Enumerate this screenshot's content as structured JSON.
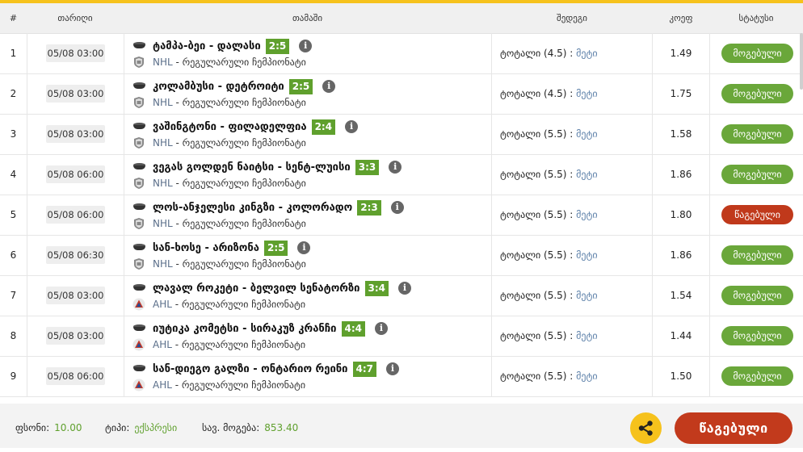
{
  "header": {
    "num": "#",
    "date": "თარიღი",
    "match": "თამაში",
    "bet": "შედეგი",
    "odds": "კოეფ",
    "status": "სტატუსი"
  },
  "colors": {
    "accent": "#f6c21c",
    "won": "#6aa73a",
    "lost": "#c0391b",
    "score": "#5fa02d"
  },
  "rows": [
    {
      "num": "1",
      "date": "05/08 03:00",
      "teams": "ტამპა-ბეი - დალასი",
      "score": "2:5",
      "league": "NHL",
      "stage": " - რეგულარული ჩემპიონატი",
      "bet": "ტოტალი (4.5) : ",
      "pick": "მეტი",
      "odds": "1.49",
      "status": "მოგებული",
      "league_icon": "nhl-logo"
    },
    {
      "num": "2",
      "date": "05/08 03:00",
      "teams": "კოლამბუსი - დეტროიტი",
      "score": "2:5",
      "league": "NHL",
      "stage": " - რეგულარული ჩემპიონატი",
      "bet": "ტოტალი (4.5) : ",
      "pick": "მეტი",
      "odds": "1.75",
      "status": "მოგებული",
      "league_icon": "nhl-logo"
    },
    {
      "num": "3",
      "date": "05/08 03:00",
      "teams": "ვაშინგტონი - ფილადელფია",
      "score": "2:4",
      "league": "NHL",
      "stage": " - რეგულარული ჩემპიონატი",
      "bet": "ტოტალი (5.5) : ",
      "pick": "მეტი",
      "odds": "1.58",
      "status": "მოგებული",
      "league_icon": "nhl-logo"
    },
    {
      "num": "4",
      "date": "05/08 06:00",
      "teams": "ვეგას გოლდენ ნაიტსი - სენტ-ლუისი",
      "score": "3:3",
      "league": "NHL",
      "stage": " - რეგულარული ჩემპიონატი",
      "bet": "ტოტალი (5.5) : ",
      "pick": "მეტი",
      "odds": "1.86",
      "status": "მოგებული",
      "league_icon": "nhl-logo"
    },
    {
      "num": "5",
      "date": "05/08 06:00",
      "teams": "ლოს-ანჯელესი კინგზი - კოლორადო",
      "score": "2:3",
      "league": "NHL",
      "stage": " - რეგულარული ჩემპიონატი",
      "bet": "ტოტალი (5.5) : ",
      "pick": "მეტი",
      "odds": "1.80",
      "status": "წაგებული",
      "league_icon": "nhl-logo"
    },
    {
      "num": "6",
      "date": "05/08 06:30",
      "teams": "სან-ხოსე - არიზონა",
      "score": "2:5",
      "league": "NHL",
      "stage": " - რეგულარული ჩემპიონატი",
      "bet": "ტოტალი (5.5) : ",
      "pick": "მეტი",
      "odds": "1.86",
      "status": "მოგებული",
      "league_icon": "nhl-logo"
    },
    {
      "num": "7",
      "date": "05/08 03:00",
      "teams": "ლავალ როკეტი - ბელვილ სენატორზი",
      "score": "3:4",
      "league": "AHL",
      "stage": " - რეგულარული ჩემპიონატი",
      "bet": "ტოტალი (5.5) : ",
      "pick": "მეტი",
      "odds": "1.54",
      "status": "მოგებული",
      "league_icon": "ahl-logo"
    },
    {
      "num": "8",
      "date": "05/08 03:00",
      "teams": "იუტიკა კომეტსი - სირაკუზ კრანჩი",
      "score": "4:4",
      "league": "AHL",
      "stage": " - რეგულარული ჩემპიონატი",
      "bet": "ტოტალი (5.5) : ",
      "pick": "მეტი",
      "odds": "1.44",
      "status": "მოგებული",
      "league_icon": "ahl-logo"
    },
    {
      "num": "9",
      "date": "05/08 06:00",
      "teams": "სან-დიეგო გალზი - ონტარიო რეინი",
      "score": "4:7",
      "league": "AHL",
      "stage": " - რეგულარული ჩემპიონატი",
      "bet": "ტოტალი (5.5) : ",
      "pick": "მეტი",
      "odds": "1.50",
      "status": "მოგებული",
      "league_icon": "ahl-logo"
    }
  ],
  "footer": {
    "stake_label": "ფსონი:",
    "stake_value": "10.00",
    "type_label": "ტიპი:",
    "type_value": "ექსპრესი",
    "win_label": "სავ. მოგება:",
    "win_value": "853.40",
    "result_button": "წაგებული"
  }
}
